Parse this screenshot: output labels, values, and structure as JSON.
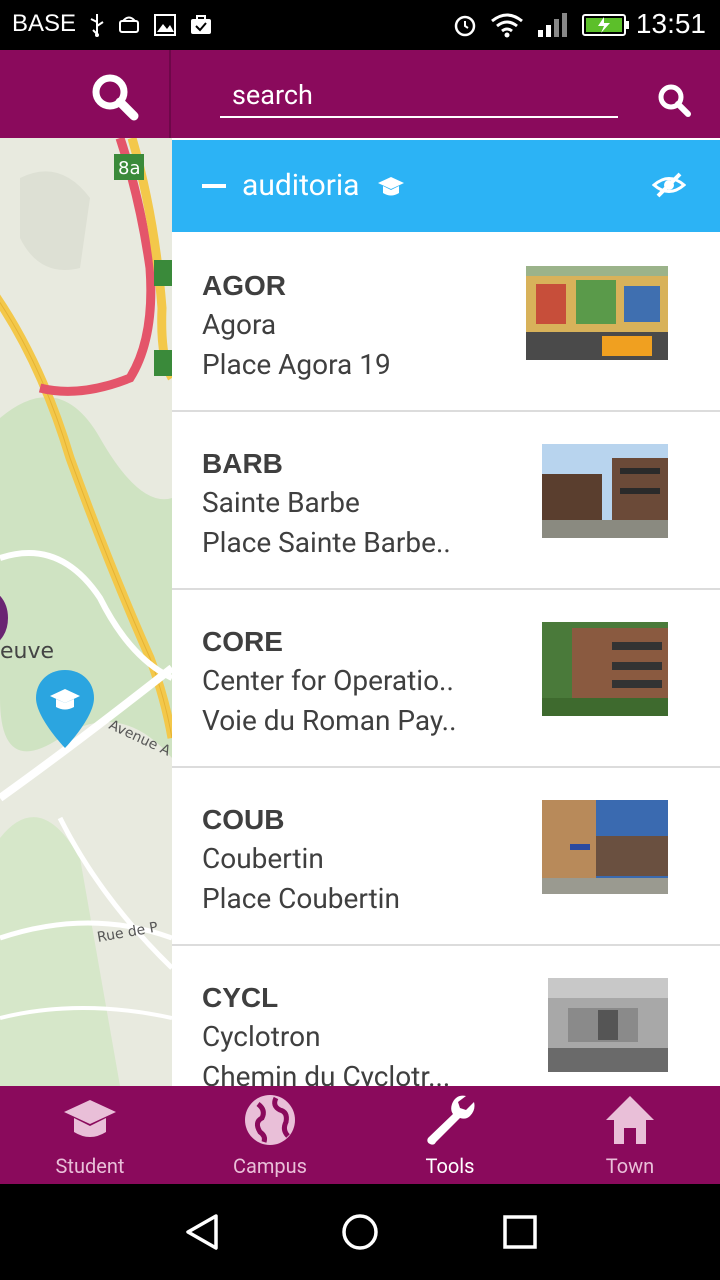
{
  "status_bar": {
    "carrier": "BASE",
    "time": "13:51"
  },
  "search": {
    "placeholder": "search"
  },
  "category": {
    "label": "auditoria"
  },
  "items": [
    {
      "code": "AGOR",
      "name": "Agora",
      "address": "Place Agora 19"
    },
    {
      "code": "BARB",
      "name": "Sainte Barbe",
      "address": "Place Sainte Barbe.."
    },
    {
      "code": "CORE",
      "name": "Center for Operatio..",
      "address": "Voie du Roman Pay.."
    },
    {
      "code": "COUB",
      "name": "Coubertin",
      "address": "Place Coubertin"
    },
    {
      "code": "CYCL",
      "name": "Cyclotron",
      "address": "Chemin du Cyclotr..."
    }
  ],
  "map": {
    "labels": [
      "8a",
      "euve",
      "Avenue A",
      "Rue de P"
    ]
  },
  "bottom_nav": [
    {
      "label": "Student",
      "icon": "graduation-cap-icon"
    },
    {
      "label": "Campus",
      "icon": "globe-icon"
    },
    {
      "label": "Tools",
      "icon": "wrench-icon"
    },
    {
      "label": "Town",
      "icon": "home-icon"
    }
  ],
  "colors": {
    "primary": "#8a0a5c",
    "header": "#2cb3f5"
  }
}
